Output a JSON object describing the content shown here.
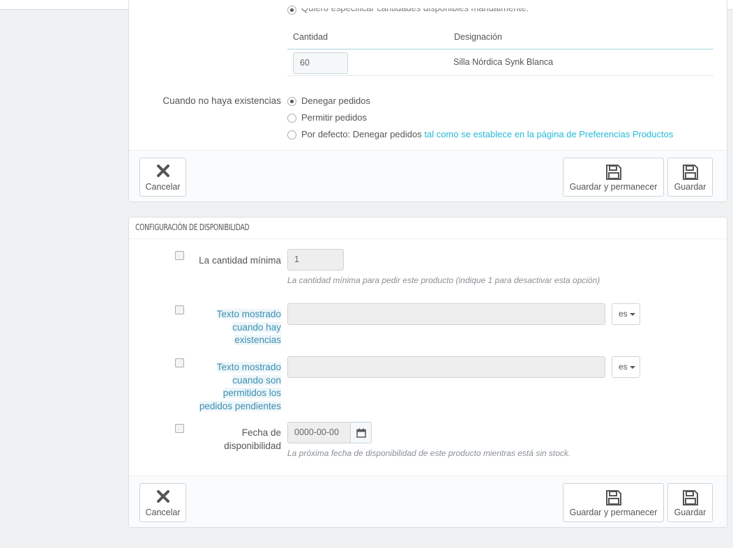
{
  "top_panel": {
    "radio_manual_label": "Quiero especificar cantidades disponibles manualmente.",
    "table": {
      "headers": [
        "Cantidad",
        "Designación"
      ],
      "row": {
        "quantity": "60",
        "designation": "Silla Nórdica Synk Blanca"
      }
    },
    "out_of_stock": {
      "label": "Cuando no haya existencias",
      "options": [
        {
          "label": "Denegar pedidos",
          "selected": true
        },
        {
          "label": "Permitir pedidos",
          "selected": false
        },
        {
          "label": "Por defecto: Denegar pedidos",
          "link": "tal como se establece en la página de Preferencias Productos",
          "selected": false
        }
      ]
    }
  },
  "footer_buttons": {
    "cancel": "Cancelar",
    "save_stay": "Guardar y permanecer",
    "save": "Guardar"
  },
  "availability_panel": {
    "heading": "CONFIGURACIÓN DE DISPONIBILIDAD",
    "min_qty": {
      "label": "La cantidad mínima",
      "value": "1",
      "help": "La cantidad mínima para pedir este producto (indique 1 para desactivar esta opción)"
    },
    "in_stock_text": {
      "label_lines": [
        "Texto mostrado",
        "cuando hay",
        "existencias"
      ],
      "value": "",
      "lang": "es"
    },
    "backorder_text": {
      "label_lines": [
        "Texto mostrado",
        "cuando son",
        "permitidos los",
        "pedidos pendientes"
      ],
      "value": "",
      "lang": "es"
    },
    "availability_date": {
      "label_lines": [
        "Fecha de",
        "disponibilidad"
      ],
      "value": "0000-00-00",
      "help": "La próxima fecha de disponibilidad de este producto mientras está sin stock."
    }
  },
  "colors": {
    "background": "#eff1f2",
    "accent_link": "#25b9d7",
    "highlight_label": "#3a8fb0"
  }
}
